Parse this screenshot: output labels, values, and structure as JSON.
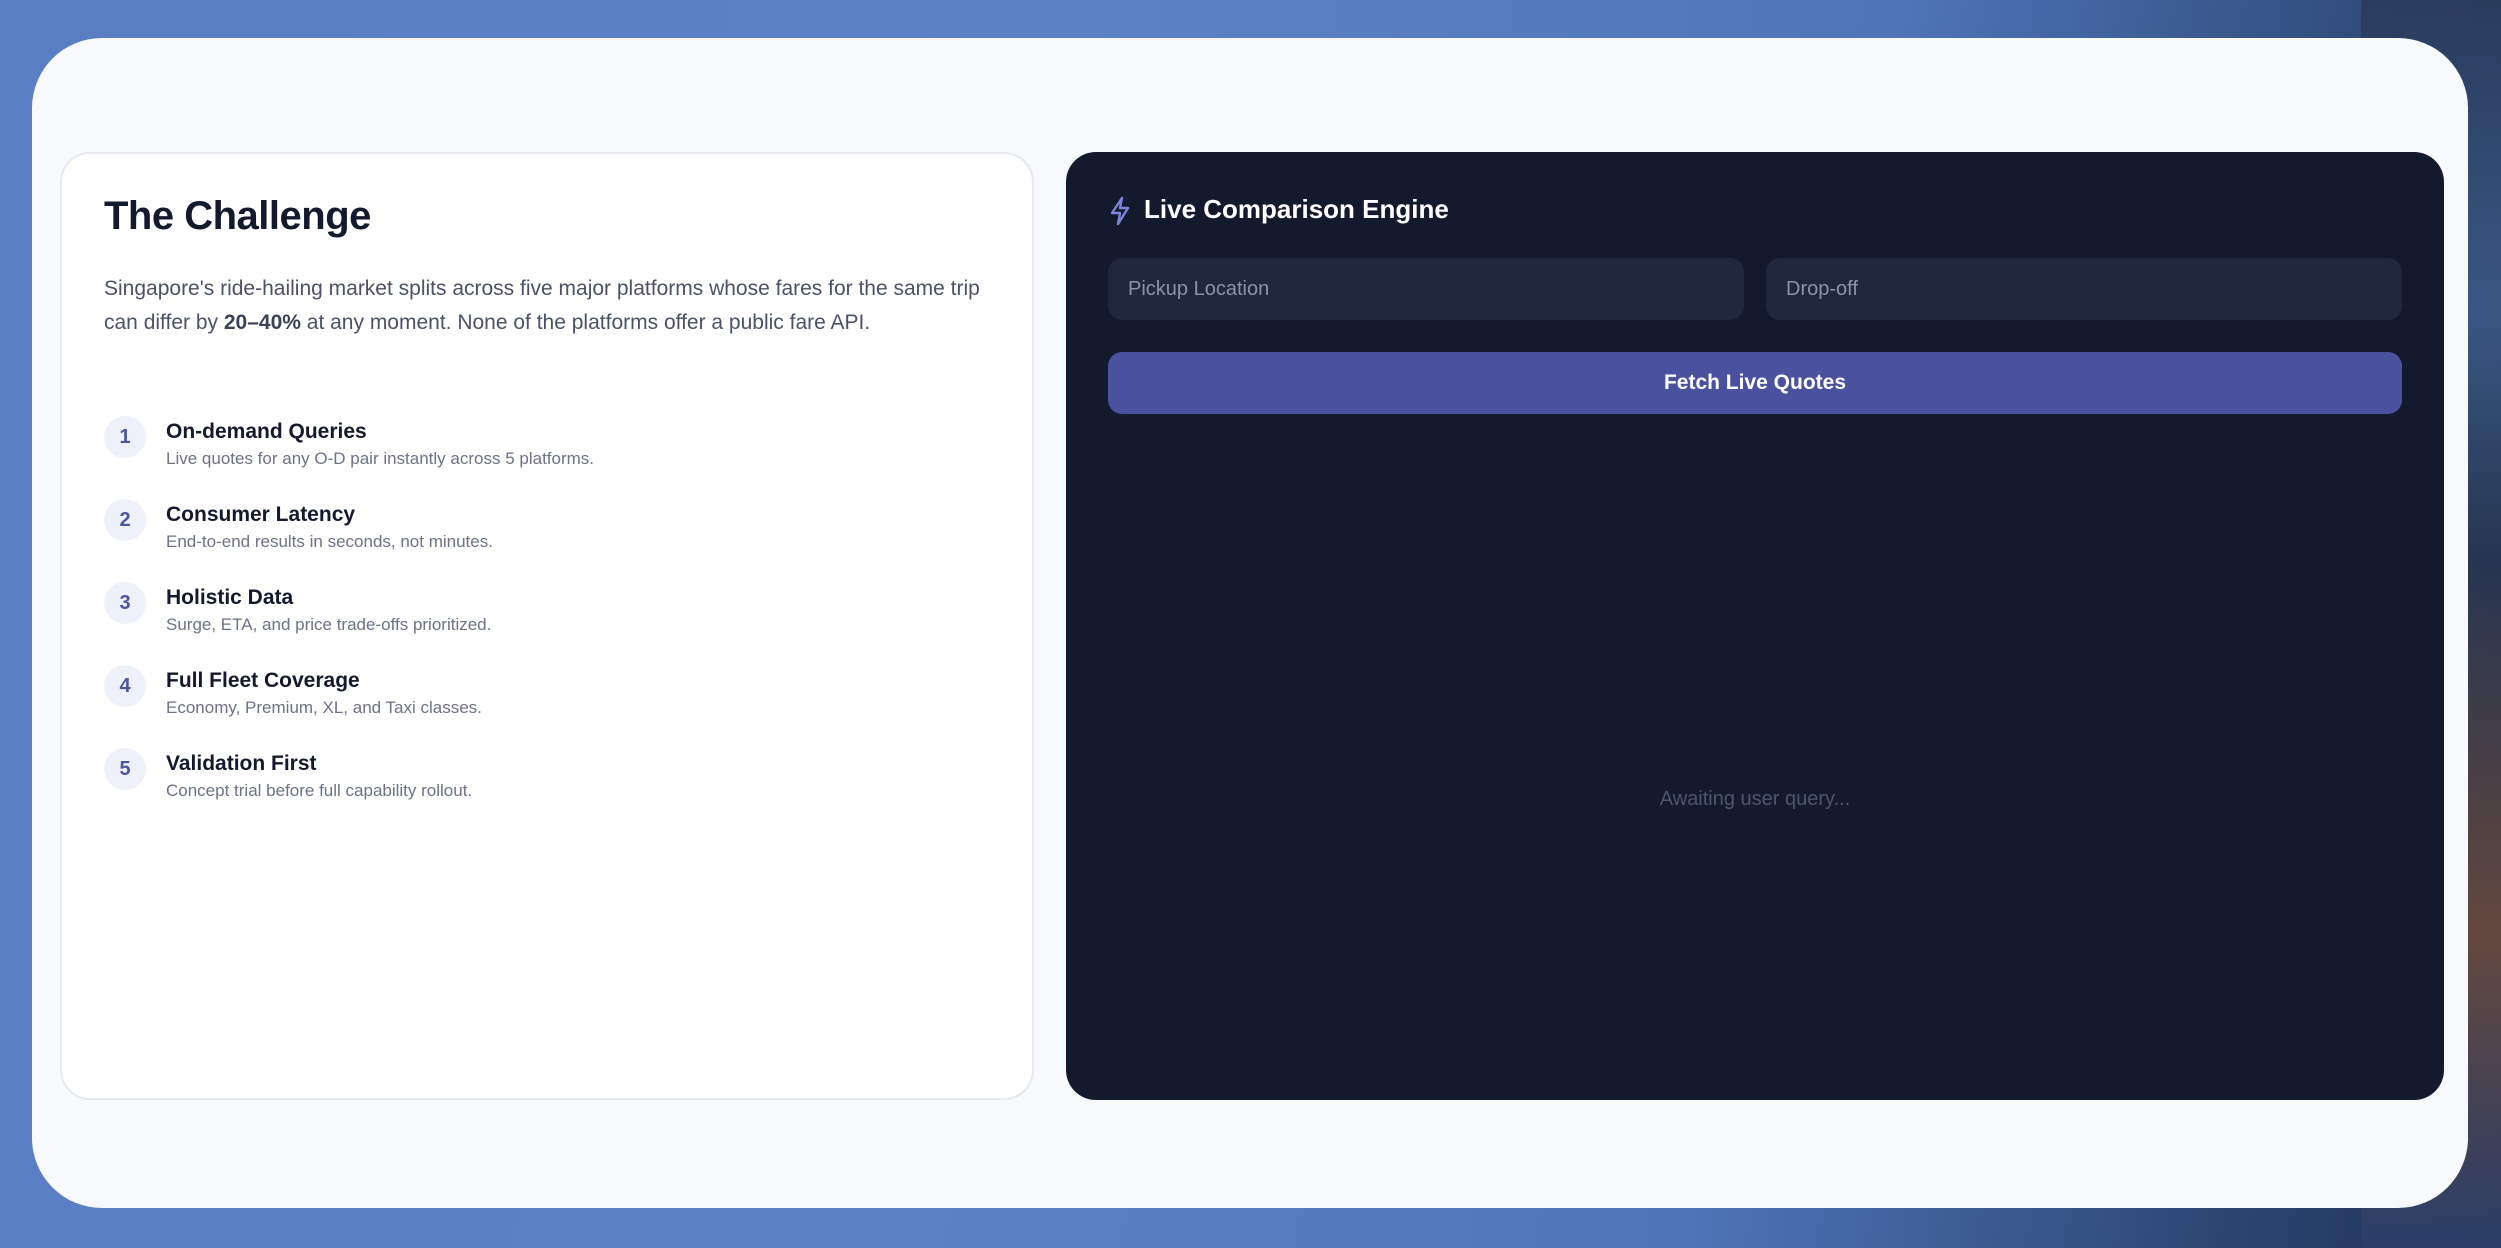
{
  "challenge": {
    "title": "The Challenge",
    "intro_before": "Singapore's ride-hailing market splits across five major platforms whose fares for the same trip can differ by ",
    "intro_bold": "20–40%",
    "intro_after": " at any moment. None of the platforms offer a public fare API.",
    "requirements": [
      {
        "num": "1",
        "title": "On-demand Queries",
        "desc": "Live quotes for any O-D pair instantly across 5 platforms."
      },
      {
        "num": "2",
        "title": "Consumer Latency",
        "desc": "End-to-end results in seconds, not minutes."
      },
      {
        "num": "3",
        "title": "Holistic Data",
        "desc": "Surge, ETA, and price trade-offs prioritized."
      },
      {
        "num": "4",
        "title": "Full Fleet Coverage",
        "desc": "Economy, Premium, XL, and Taxi classes."
      },
      {
        "num": "5",
        "title": "Validation First",
        "desc": "Concept trial before full capability rollout."
      }
    ]
  },
  "engine": {
    "icon": "lightning-icon",
    "title": "Live Comparison Engine",
    "pickup_placeholder": "Pickup Location",
    "dropoff_placeholder": "Drop-off",
    "fetch_label": "Fetch Live Quotes",
    "status": "Awaiting user query..."
  },
  "colors": {
    "accent": "#4a52a0",
    "dark_panel": "#141a2e",
    "icon_accent": "#7c86d8"
  }
}
